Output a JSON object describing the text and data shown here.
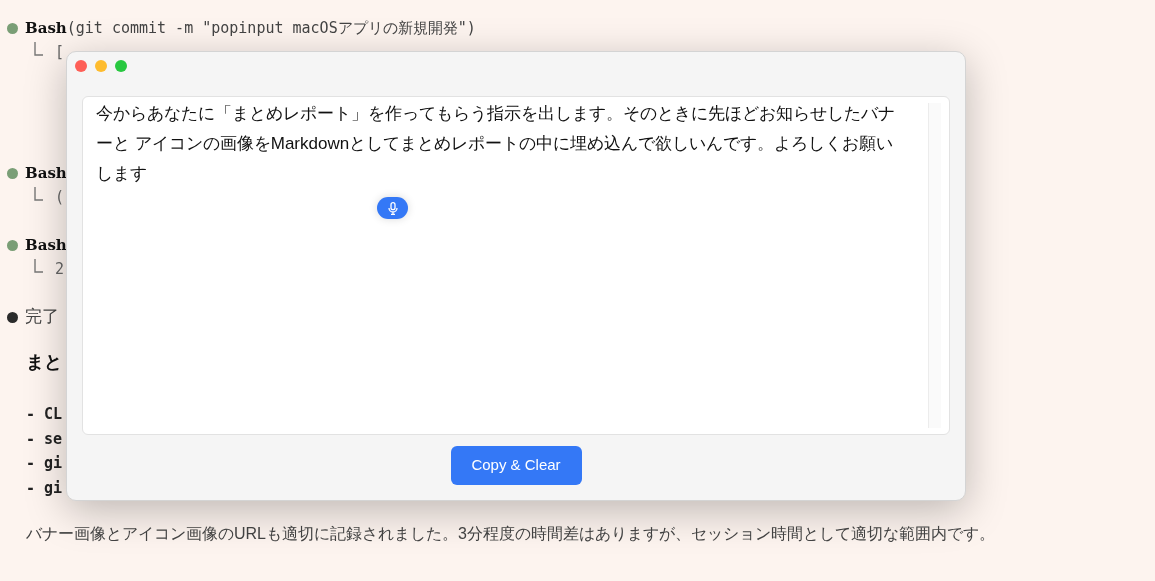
{
  "transcript": [
    {
      "kind": "tool",
      "color": "#7a9e76",
      "name": "Bash",
      "args": "(git commit -m \"popinput macOSアプリの新規開発\")",
      "output": "["
    },
    {
      "kind": "tool",
      "color": "#7a9e76",
      "name": "Bash",
      "output": "("
    },
    {
      "kind": "tool",
      "color": "#7a9e76",
      "name": "Bash",
      "output": "2"
    },
    {
      "kind": "message",
      "color": "#2b2b2b",
      "text": "完了"
    }
  ],
  "heading": "まと",
  "list_items": [
    "- CL",
    "- se",
    "- gi",
    "- gi"
  ],
  "paragraph": "バナー画像とアイコン画像のURLも適切に記録されました。3分程度の時間差はありますが、セッション時間として適切な範囲内です。",
  "popup": {
    "text": "今からあなたに「まとめレポート」を作ってもらう指示を出します。そのときに先ほどお知らせしたバナーと アイコンの画像をMarkdownとしてまとめレポートの中に埋め込んで欲しいんです。よろしくお願いします",
    "button": "Copy & Clear"
  }
}
